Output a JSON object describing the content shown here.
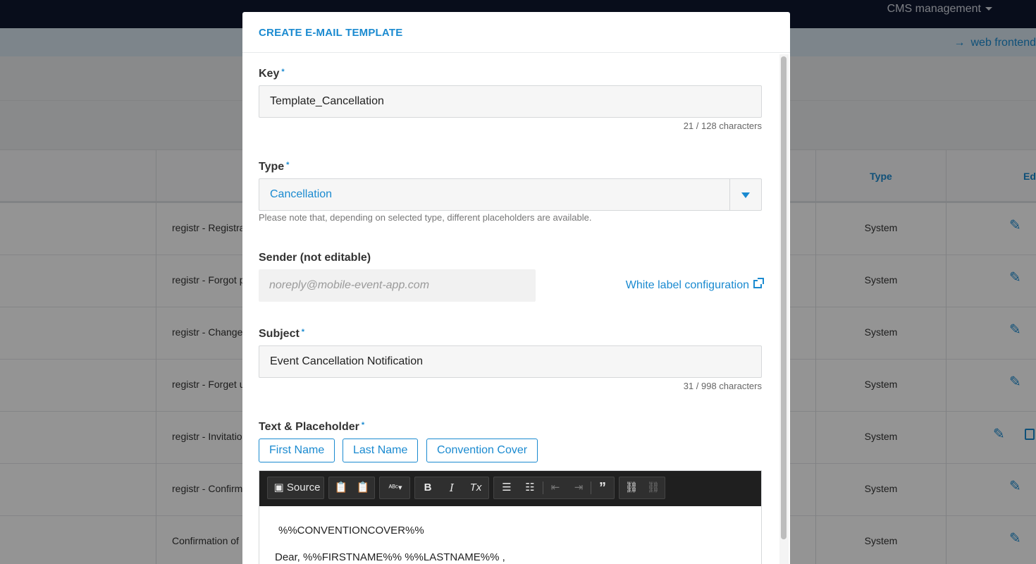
{
  "app": {
    "cms_menu_label": "CMS management",
    "web_frontend_label": "web frontend"
  },
  "table": {
    "header_type": "Type",
    "header_edit": "Edi",
    "rows": [
      {
        "name": "registr - Registra",
        "type": "System"
      },
      {
        "name": "registr - Forgot p",
        "type": "System"
      },
      {
        "name": "registr - Change",
        "type": "System"
      },
      {
        "name": "registr - Forget u",
        "type": "System"
      },
      {
        "name": "registr - Invitatio",
        "type": "System"
      },
      {
        "name": "registr - Confirm",
        "type": "System"
      },
      {
        "name": "Confirmation of",
        "type": "System"
      }
    ]
  },
  "modal": {
    "title": "CREATE E-MAIL TEMPLATE",
    "key": {
      "label": "Key",
      "required_mark": "*",
      "value": "Template_Cancellation",
      "counter": "21 / 128 characters"
    },
    "type": {
      "label": "Type",
      "required_mark": "*",
      "value": "Cancellation",
      "hint": "Please note that, depending on selected type, different placeholders are available."
    },
    "sender": {
      "label": "Sender (not editable)",
      "value": "noreply@mobile-event-app.com",
      "link_label": "White label configuration"
    },
    "subject": {
      "label": "Subject",
      "required_mark": "*",
      "value": "Event Cancellation Notification",
      "counter": "31 / 998 characters"
    },
    "text": {
      "label": "Text & Placeholder",
      "required_mark": "*",
      "placeholders": [
        "First Name",
        "Last Name",
        "Convention Cover"
      ],
      "toolbar_source": "Source",
      "body_line1": "%%CONVENTIONCOVER%%",
      "body_line2": "Dear,  %%FIRSTNAME%%  %%LASTNAME%% ,"
    }
  },
  "colors": {
    "accent": "#1a8ad0",
    "topbar": "#0e1730",
    "editor_toolbar": "#1f1f1f"
  }
}
